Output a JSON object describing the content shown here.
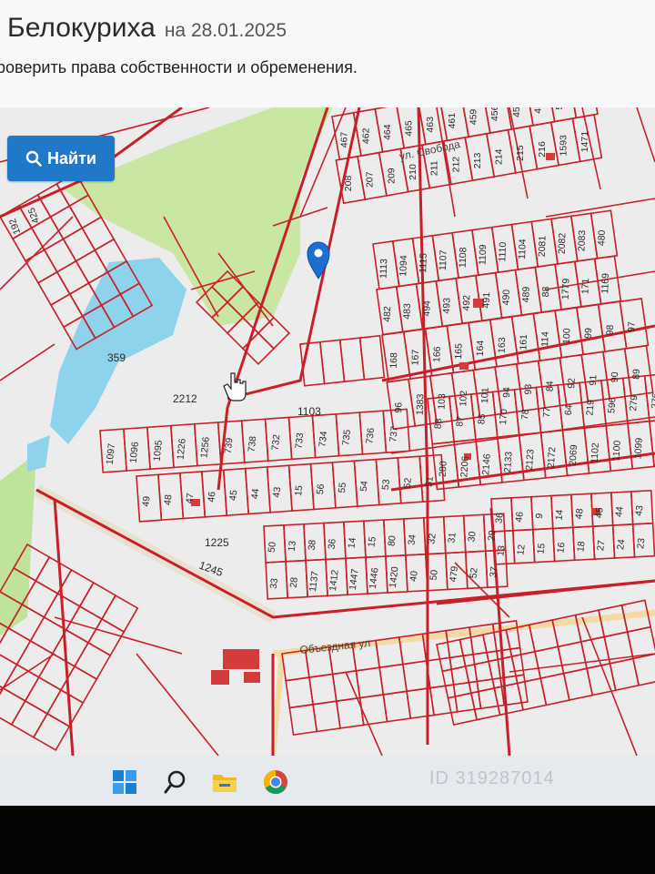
{
  "header": {
    "city": "Белокуриха",
    "date": "на 28.01.2025",
    "subtitle": "роверить права собственности и обременения."
  },
  "search_button": {
    "label": "Найти"
  },
  "map": {
    "streets": [
      "ул. Свобода",
      "Объездная ул"
    ],
    "area_labels": [
      "359",
      "2212",
      "1103",
      "1225",
      "1245"
    ],
    "parcel_numbers": [
      "467",
      "462",
      "464",
      "465",
      "463",
      "461",
      "459",
      "456",
      "455",
      "453",
      "554",
      "553",
      "208",
      "207",
      "209",
      "210",
      "211",
      "212",
      "213",
      "214",
      "215",
      "216",
      "1593",
      "1471",
      "1113",
      "1094",
      "1115",
      "1107",
      "1108",
      "1109",
      "1110",
      "1104",
      "2081",
      "2082",
      "2083",
      "480",
      "482",
      "483",
      "494",
      "493",
      "492",
      "491",
      "490",
      "489",
      "88",
      "1779",
      "171",
      "1169",
      "168",
      "167",
      "166",
      "165",
      "164",
      "163",
      "161",
      "114",
      "100",
      "99",
      "98",
      "97",
      "96",
      "1383",
      "103",
      "102",
      "101",
      "94",
      "93",
      "84",
      "92",
      "91",
      "90",
      "89",
      "88",
      "87",
      "85",
      "170",
      "78",
      "77",
      "64",
      "219",
      "596",
      "279",
      "276",
      "280",
      "2206",
      "2146",
      "2133",
      "2123",
      "2172",
      "2069",
      "1102",
      "1100",
      "1099",
      "1098",
      "1097",
      "1096",
      "1095",
      "1226",
      "1256",
      "739",
      "738",
      "732",
      "733",
      "734",
      "735",
      "736",
      "737",
      "49",
      "48",
      "47",
      "46",
      "45",
      "44",
      "43",
      "15",
      "56",
      "55",
      "54",
      "53",
      "52",
      "51",
      "50",
      "13",
      "38",
      "36",
      "14",
      "15",
      "80",
      "34",
      "32",
      "31",
      "30",
      "29",
      "33",
      "28",
      "1137",
      "1412",
      "1447",
      "1446",
      "1420",
      "40",
      "50",
      "479",
      "52",
      "37",
      "36",
      "46",
      "9",
      "14",
      "48",
      "45",
      "44",
      "43",
      "13",
      "12",
      "15",
      "16",
      "18",
      "27",
      "24",
      "23",
      "192",
      "425"
    ],
    "marker_icon": "location-pin-icon",
    "cursor_icon": "hand-cursor-icon"
  },
  "taskbar": {
    "icons": [
      "windows-start-icon",
      "search-icon",
      "file-explorer-icon",
      "chrome-icon"
    ]
  },
  "watermark": "ID 319287014"
}
